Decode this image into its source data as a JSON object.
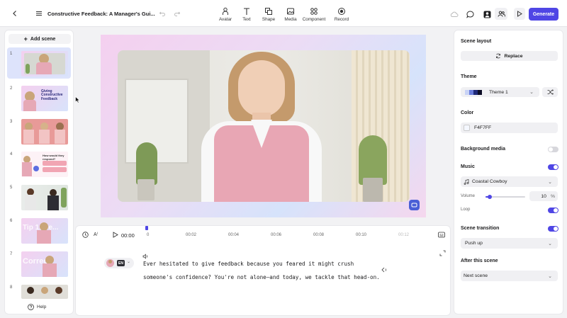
{
  "header": {
    "title": "Constructive Feedback: A Manager's Gui...",
    "tools": [
      {
        "label": "Avatar",
        "icon": "avatar-icon"
      },
      {
        "label": "Text",
        "icon": "text-icon"
      },
      {
        "label": "Shape",
        "icon": "shape-icon"
      },
      {
        "label": "Media",
        "icon": "media-icon"
      },
      {
        "label": "Component",
        "icon": "component-icon"
      },
      {
        "label": "Record",
        "icon": "record-icon"
      }
    ],
    "generate_label": "Generate",
    "accent": "#4f46e5"
  },
  "sidebar": {
    "add_scene_label": "Add scene",
    "scenes": [
      {
        "num": "1",
        "thumb_text": ""
      },
      {
        "num": "2",
        "thumb_text": "Giving Constructive Feedback"
      },
      {
        "num": "3",
        "thumb_text": ""
      },
      {
        "num": "4",
        "thumb_text": "How would they respond?"
      },
      {
        "num": "5",
        "thumb_text": ""
      },
      {
        "num": "6",
        "thumb_text": "Tip 1: Be..."
      },
      {
        "num": "7",
        "thumb_text": "Correct"
      },
      {
        "num": "8",
        "thumb_text": ""
      }
    ],
    "help_label": "Help"
  },
  "timeline": {
    "current_time": "00:00",
    "ticks": [
      "0",
      "00:02",
      "00:04",
      "00:06",
      "00:08",
      "00:10",
      "00:12"
    ],
    "language_badge": "EN",
    "script_lines": [
      "Ever hesitated to give feedback because you feared it might crush",
      "someone's confidence? You're not alone—and today, we tackle that head-on."
    ]
  },
  "properties": {
    "scene_layout_heading": "Scene layout",
    "replace_label": "Replace",
    "theme_heading": "Theme",
    "theme_value": "Theme 1",
    "theme_swatches": [
      "#c9d3f6",
      "#6a7ddb",
      "#1f2a7a",
      "#0c0c26"
    ],
    "color_heading": "Color",
    "color_value": "F4F7FF",
    "color_swatch": "#F4F7FF",
    "background_media_label": "Background media",
    "background_media_on": false,
    "music_label": "Music",
    "music_on": true,
    "music_track": "Coastal Cowboy",
    "volume_label": "Volume",
    "volume_value": "10",
    "volume_unit": "%",
    "volume_fraction": 0.1,
    "loop_label": "Loop",
    "loop_on": true,
    "scene_transition_label": "Scene transition",
    "scene_transition_on": true,
    "transition_value": "Push up",
    "after_scene_heading": "After this scene",
    "after_scene_value": "Next scene"
  }
}
